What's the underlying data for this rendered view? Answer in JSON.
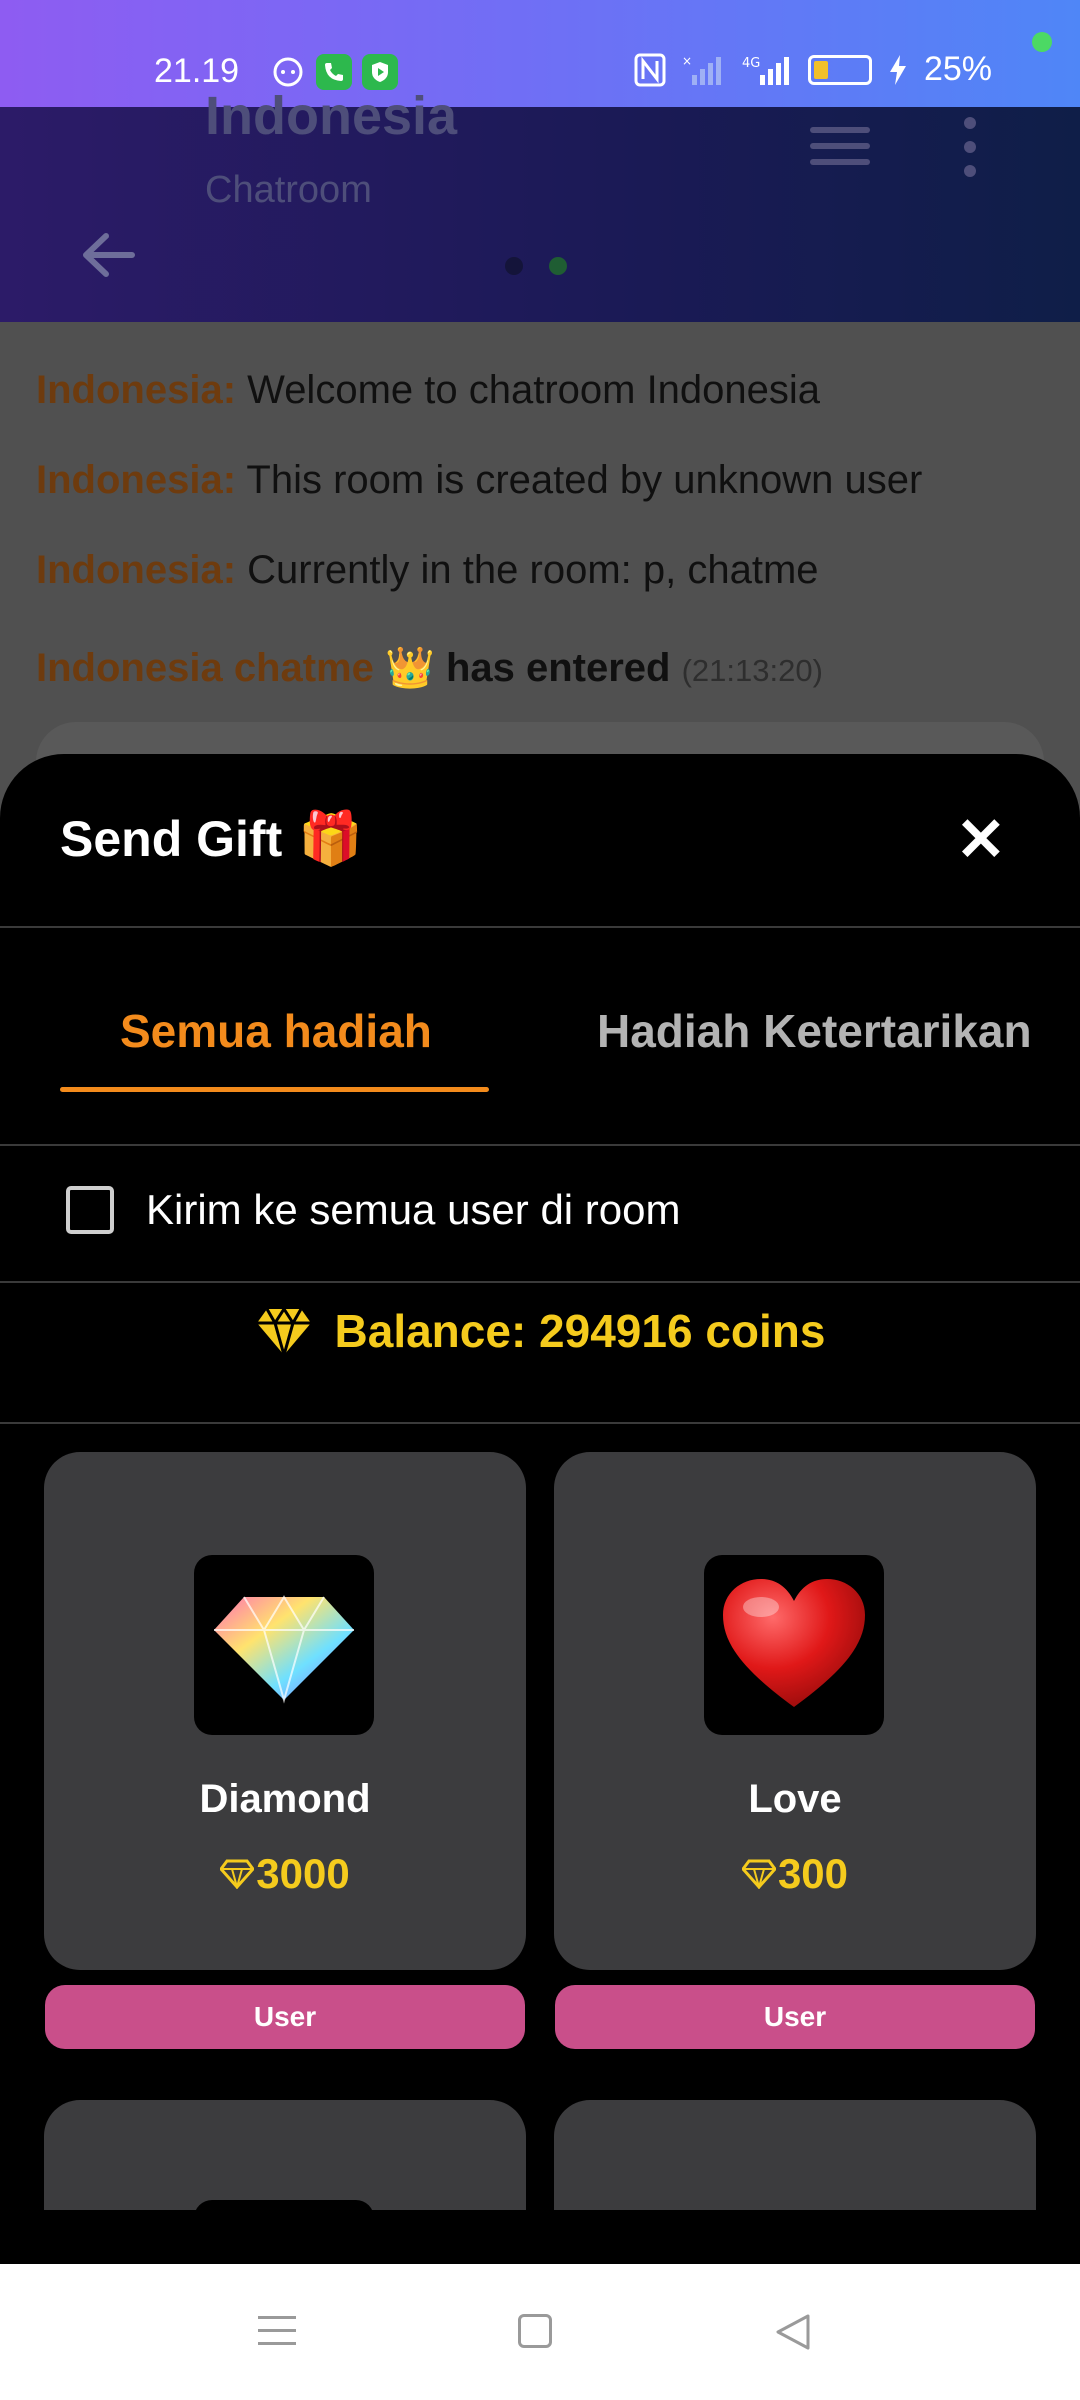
{
  "status_bar": {
    "time": "21.19",
    "battery_percent": "25%",
    "battery_level": 0.25,
    "left_icons": [
      "chat-icon",
      "phone-icon",
      "shield-icon"
    ],
    "right_icons": [
      "nfc-icon",
      "signal-icon",
      "4g-signal-icon",
      "battery-icon",
      "charging-icon"
    ]
  },
  "header": {
    "title": "Indonesia",
    "subtitle": "Chatroom"
  },
  "chat": {
    "messages": [
      {
        "sender": "Indonesia:",
        "text": "Welcome to chatroom Indonesia"
      },
      {
        "sender": "Indonesia:",
        "text": "This room is created by unknown user"
      },
      {
        "sender": "Indonesia:",
        "text": "Currently in the room: p, chatme"
      }
    ],
    "entry": {
      "sender": "Indonesia chatme",
      "crown": "👑",
      "action": "has entered",
      "time": "(21:13:20)"
    }
  },
  "sheet": {
    "title": "Send Gift",
    "title_emoji": "🎁",
    "close_label": "✕",
    "tabs": [
      {
        "label": "Semua hadiah",
        "active": true
      },
      {
        "label": "Hadiah Ketertarikan",
        "active": false
      }
    ],
    "send_all_label": "Kirim ke semua user di room",
    "send_all_checked": false,
    "balance": "Balance: 294916 coins",
    "gifts": [
      {
        "name": "Diamond",
        "price": "3000",
        "button": "User",
        "icon": "diamond-icon"
      },
      {
        "name": "Love",
        "price": "300",
        "button": "User",
        "icon": "heart-icon"
      }
    ]
  },
  "colors": {
    "accent": "#f38b1c",
    "coin": "#f5cb1d",
    "user_button": "#c94f8a",
    "card": "#3c3c3e"
  }
}
